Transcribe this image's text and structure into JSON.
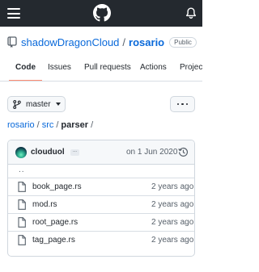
{
  "header": {
    "menu_icon": "hamburger-icon",
    "logo_icon": "github-logo-icon",
    "notification_icon": "bell-icon"
  },
  "repo": {
    "owner": "shadowDragonCloud",
    "separator": "/",
    "name": "rosario",
    "visibility": "Public"
  },
  "tabs": [
    {
      "label": "Code",
      "active": true
    },
    {
      "label": "Issues"
    },
    {
      "label": "Pull requests"
    },
    {
      "label": "Actions"
    },
    {
      "label": "Projects"
    }
  ],
  "branch": {
    "name": "master"
  },
  "breadcrumb": {
    "root": "rosario",
    "dir": "src",
    "current": "parser",
    "sep": "/"
  },
  "commit": {
    "author": "clouduol",
    "ellipsis": "...",
    "date": "on 1 Jun 2020"
  },
  "files": {
    "parent": "..",
    "rows": [
      {
        "name": "book_page.rs",
        "age": "2 years ago"
      },
      {
        "name": "mod.rs",
        "age": "2 years ago"
      },
      {
        "name": "root_page.rs",
        "age": "2 years ago"
      },
      {
        "name": "tag_page.rs",
        "age": "2 years ago"
      }
    ]
  },
  "colors": {
    "header_bg": "#24292f",
    "link": "#0969da",
    "active_tab_underline": "#fd8c73"
  }
}
